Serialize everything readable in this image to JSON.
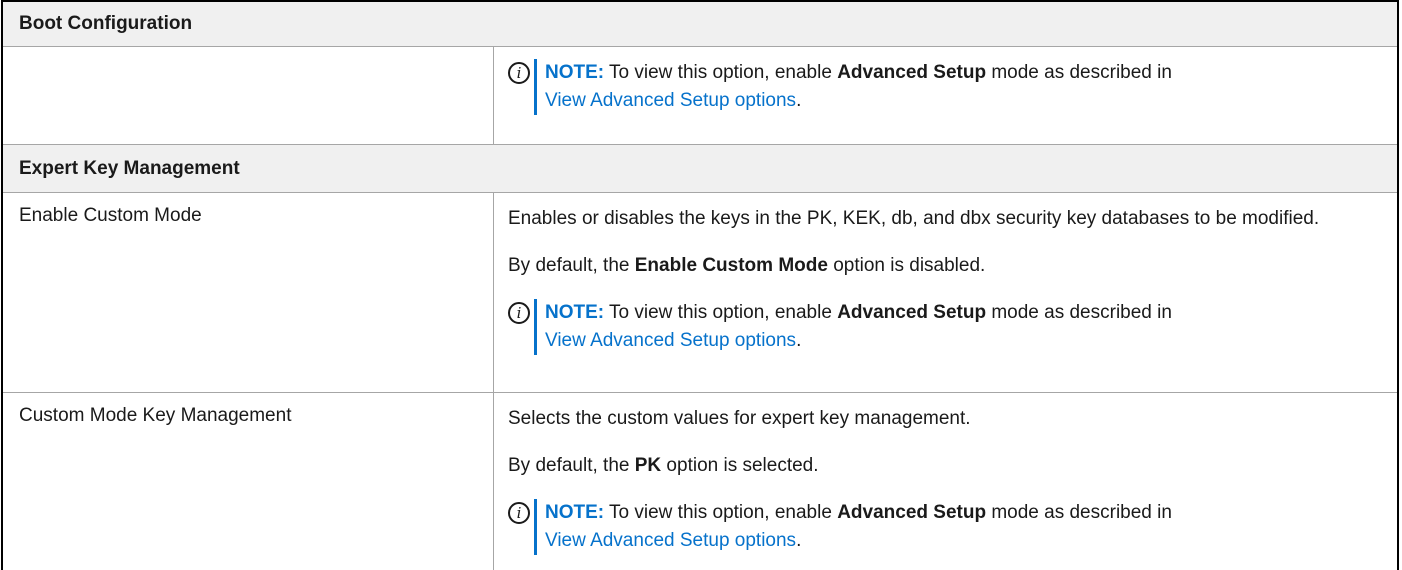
{
  "sections": {
    "boot_configuration": {
      "title": "Boot Configuration",
      "note": {
        "label": "NOTE:",
        "text_before": " To view this option, enable ",
        "bold": "Advanced Setup",
        "text_after": " mode as described in",
        "link": "View Advanced Setup options",
        "end": "."
      }
    },
    "expert_key_management": {
      "title": "Expert Key Management",
      "rows": [
        {
          "option": "Enable Custom Mode",
          "description": "Enables or disables the keys in the PK, KEK, db, and dbx security key databases to be modified.",
          "default_before": "By default, the ",
          "default_bold": "Enable Custom Mode",
          "default_after": " option is disabled.",
          "note": {
            "label": "NOTE:",
            "text_before": " To view this option, enable ",
            "bold": "Advanced Setup",
            "text_after": " mode as described in",
            "link": "View Advanced Setup options",
            "end": "."
          }
        },
        {
          "option": "Custom Mode Key Management",
          "description": "Selects the custom values for expert key management.",
          "default_before": "By default, the ",
          "default_bold": "PK",
          "default_after": " option is selected.",
          "note": {
            "label": "NOTE:",
            "text_before": " To view this option, enable ",
            "bold": "Advanced Setup",
            "text_after": " mode as described in",
            "link": "View Advanced Setup options",
            "end": "."
          }
        }
      ]
    }
  },
  "icons": {
    "note": "info-circle-icon"
  },
  "colors": {
    "accent": "#0672cb",
    "heading_bg": "#f0f0f0",
    "border": "#a6a6a6"
  }
}
